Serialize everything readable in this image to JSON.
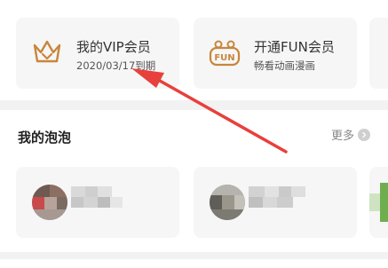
{
  "membership": {
    "vip": {
      "title": "我的VIP会员",
      "subtitle": "2020/03/17到期",
      "icon": "crown-icon"
    },
    "fun": {
      "title": "开通FUN会员",
      "subtitle": "畅看动画漫画",
      "icon": "fun-badge-icon"
    }
  },
  "bubbles": {
    "title": "我的泡泡",
    "more_label": "更多",
    "more_icon": "chevron-right-circle-icon"
  },
  "colors": {
    "accent_orange": "#c8863c",
    "annotation_red": "#e8403c",
    "card_bg": "#f6f6f6",
    "page_bg": "#f2f2f2"
  }
}
